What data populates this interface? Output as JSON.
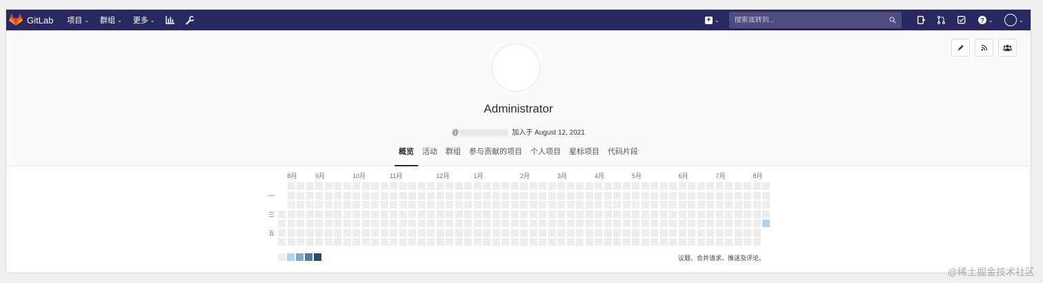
{
  "navbar": {
    "brand": "GitLab",
    "menu": [
      {
        "label": "项目",
        "caret": "⌄"
      },
      {
        "label": "群组",
        "caret": "⌄"
      },
      {
        "label": "更多",
        "caret": "⌄"
      }
    ],
    "search_placeholder": "搜索或转到..."
  },
  "profile": {
    "name": "Administrator",
    "at_sign": "@",
    "joined": "加入于 August 12, 2021"
  },
  "tabs": [
    "概览",
    "活动",
    "群组",
    "参与贡献的项目",
    "个人项目",
    "星标项目",
    "代码片段"
  ],
  "activity_calendar": {
    "months": [
      "8月",
      "9月",
      "10月",
      "11月",
      "12月",
      "1月",
      "2月",
      "3月",
      "4月",
      "5月",
      "6月",
      "7月",
      "8月"
    ],
    "days": [
      "一",
      "三",
      "五"
    ],
    "weeks": 53,
    "active_cell_week": 52,
    "active_cell_day": 4,
    "note": "议题、合并请求、推送及评论。",
    "legend_colors": [
      "#ededed",
      "#acd5f2",
      "#7fa8c9",
      "#527ba0",
      "#254e77"
    ]
  },
  "watermark": "@稀土掘金技术社区"
}
